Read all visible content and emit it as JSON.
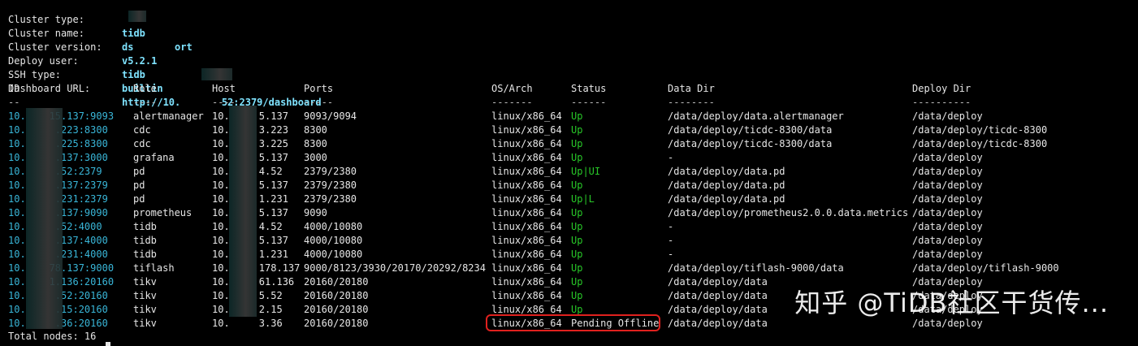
{
  "info": [
    {
      "label": "Cluster type:",
      "value": "tidb"
    },
    {
      "label": "Cluster name:",
      "value": "ds       ort"
    },
    {
      "label": "Cluster version:",
      "value": "v5.2.1"
    },
    {
      "label": "Deploy user:",
      "value": "tidb"
    },
    {
      "label": "SSH type:",
      "value": "builtin"
    },
    {
      "label": "Dashboard URL:",
      "value": "http://10.       52:2379/dashboard"
    }
  ],
  "headers": {
    "id": "ID",
    "role": "Role",
    "host": "Host",
    "ports": "Ports",
    "os": "OS/Arch",
    "status": "Status",
    "datadir": "Data Dir",
    "deploydir": "Deploy Dir"
  },
  "separators": {
    "id": "--",
    "role": "----",
    "host": "----",
    "ports": "-----",
    "os": "-------",
    "status": "------",
    "datadir": "--------",
    "deploydir": "----------"
  },
  "rows": [
    {
      "id": "10.    15.137:9093",
      "role": "alertmanager",
      "host": "10.     5.137",
      "ports": "9093/9094",
      "os": "linux/x86_64",
      "status": "Up",
      "datadir": "/data/deploy/data.alertmanager",
      "deploydir": "/data/deploy"
    },
    {
      "id": "10.     .223:8300",
      "role": "cdc",
      "host": "10.     3.223",
      "ports": "8300",
      "os": "linux/x86_64",
      "status": "Up",
      "datadir": "/data/deploy/ticdc-8300/data",
      "deploydir": "/data/deploy/ticdc-8300"
    },
    {
      "id": "10.     .225:8300",
      "role": "cdc",
      "host": "10.     3.225",
      "ports": "8300",
      "os": "linux/x86_64",
      "status": "Up",
      "datadir": "/data/deploy/ticdc-8300/data",
      "deploydir": "/data/deploy/ticdc-8300"
    },
    {
      "id": "10.     .137:3000",
      "role": "grafana",
      "host": "10.     5.137",
      "ports": "3000",
      "os": "linux/x86_64",
      "status": "Up",
      "datadir": "-",
      "deploydir": "/data/deploy"
    },
    {
      "id": "10.     .52:2379",
      "role": "pd",
      "host": "10.     4.52",
      "ports": "2379/2380",
      "os": "linux/x86_64",
      "status": "Up|UI",
      "datadir": "/data/deploy/data.pd",
      "deploydir": "/data/deploy"
    },
    {
      "id": "10.     .137:2379",
      "role": "pd",
      "host": "10.     5.137",
      "ports": "2379/2380",
      "os": "linux/x86_64",
      "status": "Up",
      "datadir": "/data/deploy/data.pd",
      "deploydir": "/data/deploy"
    },
    {
      "id": "10.     .231:2379",
      "role": "pd",
      "host": "10.     1.231",
      "ports": "2379/2380",
      "os": "linux/x86_64",
      "status": "Up|L",
      "datadir": "/data/deploy/data.pd",
      "deploydir": "/data/deploy"
    },
    {
      "id": "10.     .137:9090",
      "role": "prometheus",
      "host": "10.     5.137",
      "ports": "9090",
      "os": "linux/x86_64",
      "status": "Up",
      "datadir": "/data/deploy/prometheus2.0.0.data.metrics",
      "deploydir": "/data/deploy"
    },
    {
      "id": "10.     .52:4000",
      "role": "tidb",
      "host": "10.     4.52",
      "ports": "4000/10080",
      "os": "linux/x86_64",
      "status": "Up",
      "datadir": "-",
      "deploydir": "/data/deploy"
    },
    {
      "id": "10.     .137:4000",
      "role": "tidb",
      "host": "10.     5.137",
      "ports": "4000/10080",
      "os": "linux/x86_64",
      "status": "Up",
      "datadir": "-",
      "deploydir": "/data/deploy"
    },
    {
      "id": "10.     .231:4000",
      "role": "tidb",
      "host": "10.     1.231",
      "ports": "4000/10080",
      "os": "linux/x86_64",
      "status": "Up",
      "datadir": "-",
      "deploydir": "/data/deploy"
    },
    {
      "id": "10.    78.137:9000",
      "role": "tiflash",
      "host": "10.     178.137",
      "ports": "9000/8123/3930/20170/20292/8234",
      "os": "linux/x86_64",
      "status": "Up",
      "datadir": "/data/deploy/tiflash-9000/data",
      "deploydir": "/data/deploy/tiflash-9000"
    },
    {
      "id": "10.    1.136:20160",
      "role": "tikv",
      "host": "10.     61.136",
      "ports": "20160/20180",
      "os": "linux/x86_64",
      "status": "Up",
      "datadir": "/data/deploy/data",
      "deploydir": "/data/deploy"
    },
    {
      "id": "10.     .52:20160",
      "role": "tikv",
      "host": "10.     5.52",
      "ports": "20160/20180",
      "os": "linux/x86_64",
      "status": "Up",
      "datadir": "/data/deploy/data",
      "deploydir": "/data/deploy"
    },
    {
      "id": "10.     .15:20160",
      "role": "tikv",
      "host": "10.     2.15",
      "ports": "20160/20180",
      "os": "linux/x86_64",
      "status": "Up",
      "datadir": "/data/deploy/data",
      "deploydir": "/data/deploy"
    },
    {
      "id": "10.     .36:20160",
      "role": "tikv",
      "host": "10.     3.36",
      "ports": "20160/20180",
      "os": "linux/x86_64",
      "status": "Pending Offline",
      "datadir": "/data/deploy/data",
      "deploydir": "/data/deploy"
    }
  ],
  "footer": "Total nodes: 16",
  "watermark": "知乎 @TiDB社区干货传...",
  "colors": {
    "up": "#28c828",
    "id": "#39b6d8",
    "value": "#7fe3ff",
    "highlight": "#e0211e"
  }
}
